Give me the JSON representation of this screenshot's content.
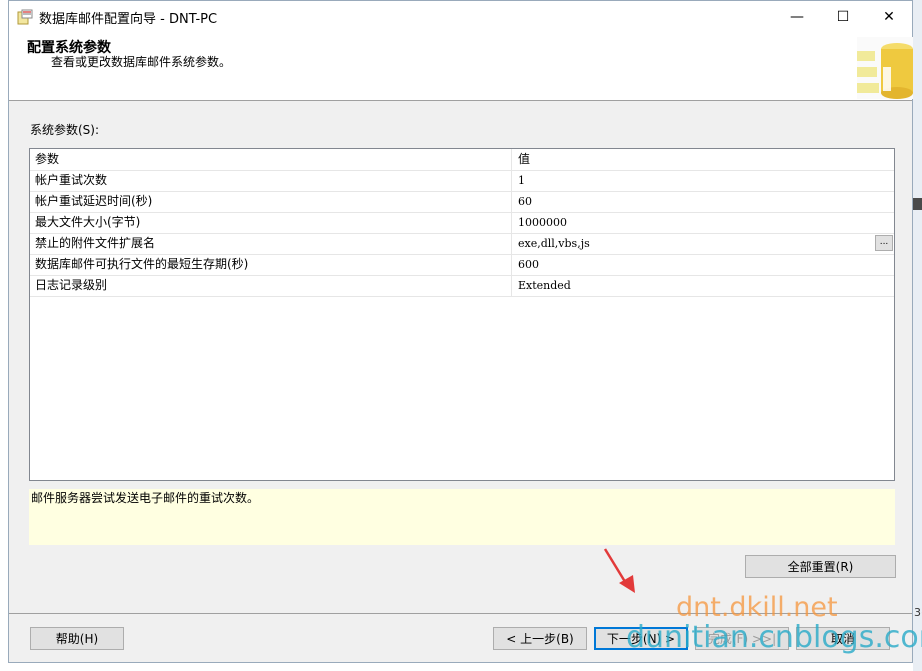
{
  "window": {
    "title": "数据库邮件配置向导 - DNT-PC",
    "minimize": "—",
    "maximize": "☐",
    "close": "✕"
  },
  "header": {
    "title": "配置系统参数",
    "subtitle": "查看或更改数据库邮件系统参数。"
  },
  "params_label": "系统参数(S):",
  "grid": {
    "columns": [
      "参数",
      "值"
    ],
    "rows": [
      {
        "name": "帐户重试次数",
        "value": "1"
      },
      {
        "name": "帐户重试延迟时间(秒)",
        "value": "60"
      },
      {
        "name": "最大文件大小(字节)",
        "value": "1000000"
      },
      {
        "name": "禁止的附件文件扩展名",
        "value": "exe,dll,vbs,js"
      },
      {
        "name": "数据库邮件可执行文件的最短生存期(秒)",
        "value": "600"
      },
      {
        "name": "日志记录级别",
        "value": "Extended"
      }
    ],
    "ellipsis": "..."
  },
  "description": "邮件服务器尝试发送电子邮件的重试次数。",
  "buttons": {
    "reset_all": "全部重置(R)",
    "help": "帮助(H)",
    "back": "< 上一步(B)",
    "next": "下一步(N) >",
    "finish": "完成(F) >>|",
    "cancel": "取消"
  },
  "watermark": {
    "line1": "dnt.dkill.net",
    "line2": "dunitian.cnblogs.com"
  },
  "colors": {
    "accent": "#0078d7",
    "description_bg": "#ffffe1"
  }
}
